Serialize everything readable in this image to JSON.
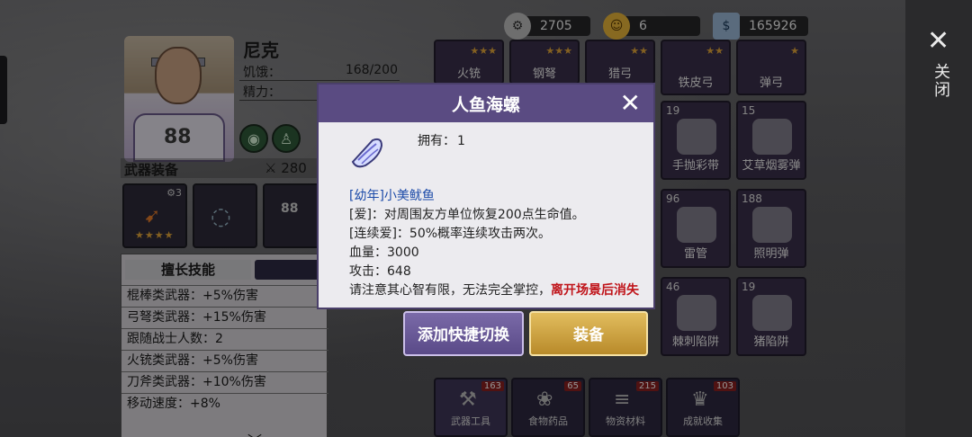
{
  "currency": {
    "gears": "2705",
    "coins": "6",
    "cash": "165926"
  },
  "character": {
    "name": "尼克",
    "hunger_label": "饥饿：",
    "hunger_value": "168/200",
    "energy_label": "精力：",
    "equipment_title": "武器装备",
    "power_value": "280",
    "equip_level": "3",
    "equip_stars": "★★★★"
  },
  "skills": {
    "tab_label": "擅长技能",
    "rows": [
      "棍棒类武器：+5%伤害",
      "弓弩类武器：+15%伤害",
      "跟随战士人数：2",
      "火铳类武器：+5%伤害",
      "刀斧类武器：+10%伤害",
      "移动速度：+8%"
    ]
  },
  "inventory": {
    "top_row": [
      {
        "name": "火铳",
        "stars": "★★★"
      },
      {
        "name": "钢弩",
        "stars": "★★★"
      },
      {
        "name": "猎弓",
        "stars": "★★"
      },
      {
        "name": "铁皮弓",
        "stars": "★★"
      },
      {
        "name": "弹弓",
        "stars": "★"
      }
    ],
    "mid_row": [
      {
        "count": "19",
        "name": "手抛彩带"
      },
      {
        "count": "15",
        "name": "艾草烟雾弹"
      }
    ],
    "row3": [
      {
        "count": "96",
        "name": "雷管"
      },
      {
        "count": "188",
        "name": "照明弹"
      }
    ],
    "row4": [
      {
        "count": "46",
        "name": "棘刺陷阱"
      },
      {
        "count": "19",
        "name": "猪陷阱"
      }
    ]
  },
  "categories": [
    {
      "label": "武器工具",
      "count": "163"
    },
    {
      "label": "食物药品",
      "count": "65"
    },
    {
      "label": "物资材料",
      "count": "215"
    },
    {
      "label": "成就收集",
      "count": "103"
    }
  ],
  "close_label": "关闭",
  "modal": {
    "title": "人鱼海螺",
    "owned_label": "拥有：",
    "owned_value": "1",
    "line_blue": "[幼年]小美鱿鱼",
    "line1": "[爱]：对周围友方单位恢复200点生命值。",
    "line2": "[连续爱]：50%概率连续攻击两次。",
    "hp": "血量：3000",
    "attack": "攻击：648",
    "note_plain": "请注意其心智有限，无法完全掌控，",
    "note_red": "离开场景后消失"
  },
  "buttons": {
    "shortcut": "添加快捷切换",
    "equip": "装备"
  }
}
